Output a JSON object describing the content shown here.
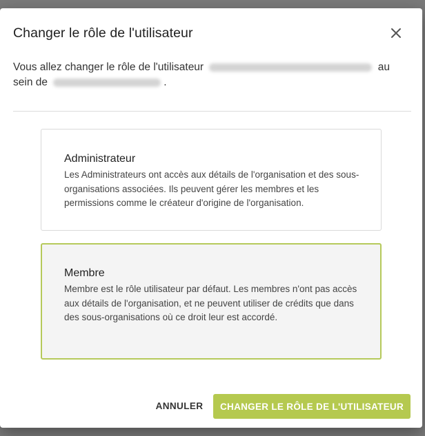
{
  "dialog": {
    "title": "Changer le rôle de l'utilisateur",
    "intro_part1": "Vous allez changer le rôle de l'utilisateur",
    "intro_part2": "au",
    "intro_part3": "sein de",
    "intro_part4": "."
  },
  "roles": [
    {
      "name": "Administrateur",
      "description": "Les Administrateurs ont accès aux détails de l'organisation et des sous-organisations associées. Ils peuvent gérer les membres et les permissions comme le créateur d'origine de l'organisation.",
      "selected": false
    },
    {
      "name": "Membre",
      "description": "Membre est le rôle utilisateur par défaut. Les membres n'ont pas accès aux détails de l'organisation, et ne peuvent utiliser de crédits que dans des sous-organisations où ce droit leur est accordé.",
      "selected": true
    }
  ],
  "actions": {
    "cancel_label": "ANNULER",
    "confirm_label": "CHANGER LE RÔLE DE L'UTILISATEUR"
  },
  "colors": {
    "accent": "#b5c94f",
    "selected_border": "#b5c95a"
  },
  "icons": {
    "close": "close-icon"
  }
}
